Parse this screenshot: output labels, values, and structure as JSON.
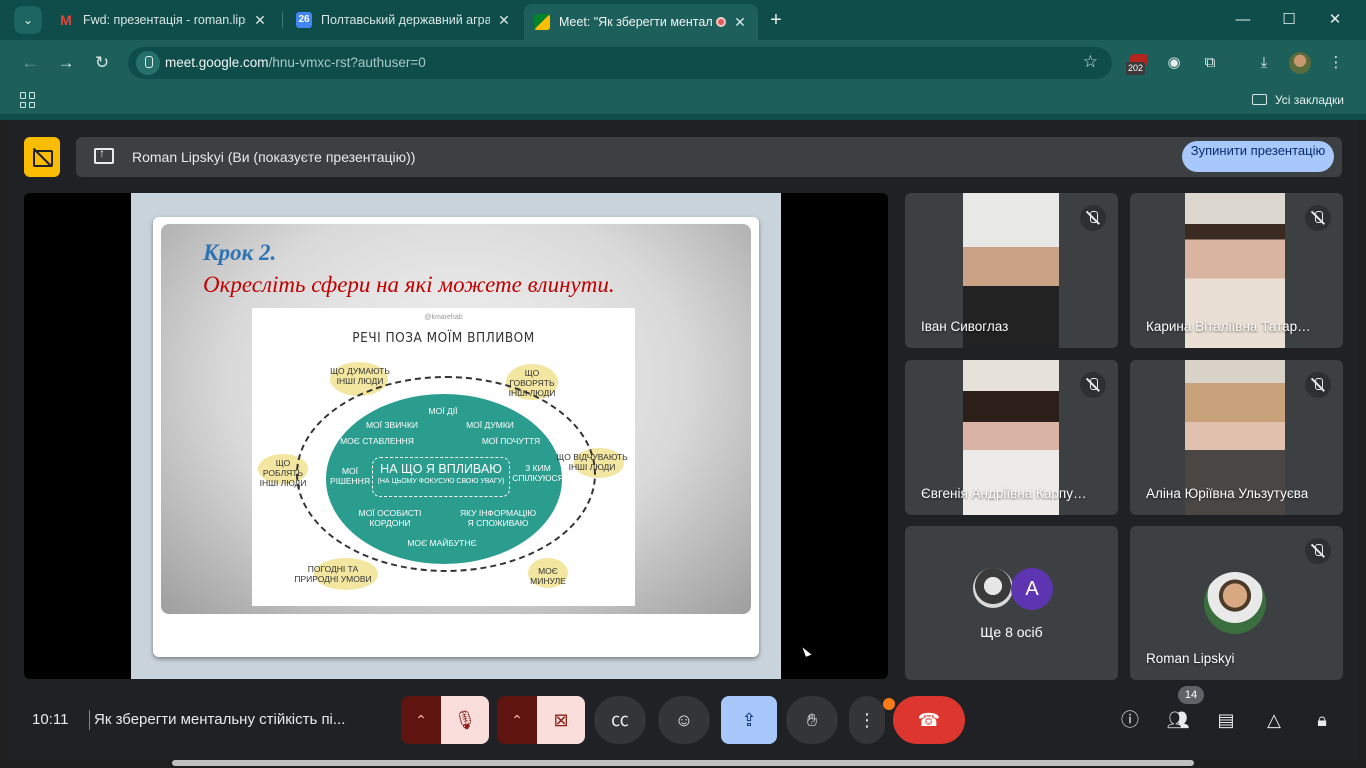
{
  "browser": {
    "tabs": [
      {
        "title": "Fwd: презентація - roman.lipsk",
        "favicon": "gmail-icon",
        "active": false
      },
      {
        "title": "Полтавський державний аграр",
        "favicon": "calendar-icon",
        "favicon_text": "26",
        "active": false
      },
      {
        "title": "Meet: \"Як зберегти менталь",
        "favicon": "meet-icon",
        "active": true
      }
    ],
    "url_host": "meet.google.com",
    "url_path": "/hnu-vmxc-rst?authuser=0",
    "extension_badge": "202",
    "bookmarks_all": "Усі закладки"
  },
  "meet": {
    "presenting_label": "Roman Lipskyi (Ви (показуєте презентацію))",
    "stop_button": "Зупинити презентацію",
    "slide": {
      "step": "Крок 2.",
      "subtitle": "Окресліть сфери на які можете влинути.",
      "poster_handle": "@kmarehab",
      "poster_title": "РЕЧІ ПОЗА МОЇМ ВПЛИВОМ",
      "center_main": "НА ЩО Я ВПЛИВАЮ",
      "center_sub": "(НА ЦЬОМУ ФОКУСУЮ СВОЮ УВАГУ)",
      "inner": [
        "МОЇ ДІЇ",
        "МОЇ ЗВИЧКИ",
        "МОЇ ДУМКИ",
        "МОЄ СТАВЛЕННЯ",
        "МОЇ ПОЧУТТЯ",
        "МОЇ РІШЕННЯ",
        "З КИМ СПІЛКУЮСЯ",
        "МОЇ ОСОБИСТІ КОРДОНИ",
        "ЯКУ ІНФОРМАЦІЮ Я СПОЖИВАЮ",
        "МОЄ МАЙБУТНЄ"
      ],
      "outer": [
        "ЩО ДУМАЮТЬ ІНШІ ЛЮДИ",
        "ЩО ГОВОРЯТЬ ІНШІ ЛЮДИ",
        "ЩО РОБЛЯТЬ ІНШІ ЛЮДИ",
        "ЩО ВІДЧУВАЮТЬ ІНШІ ЛЮДИ",
        "ПОГОДНІ ТА ПРИРОДНІ УМОВИ",
        "МОЄ МИНУЛЕ"
      ]
    },
    "participants": [
      {
        "name": "Іван Сивоглаз",
        "muted": true
      },
      {
        "name": "Карина Віталіївна Татар…",
        "muted": true
      },
      {
        "name": "Євгенія Андріївна Карпу…",
        "muted": true
      },
      {
        "name": "Аліна Юріївна Ульзутуєва",
        "muted": true
      }
    ],
    "more_people": {
      "label": "Ще 8 осіб",
      "avatar_letter": "A"
    },
    "self_tile": {
      "name": "Roman Lipskyi",
      "muted": true
    },
    "time": "10:11",
    "meeting_title": "Як зберегти ментальну стійкість пі...",
    "people_count": "14"
  }
}
